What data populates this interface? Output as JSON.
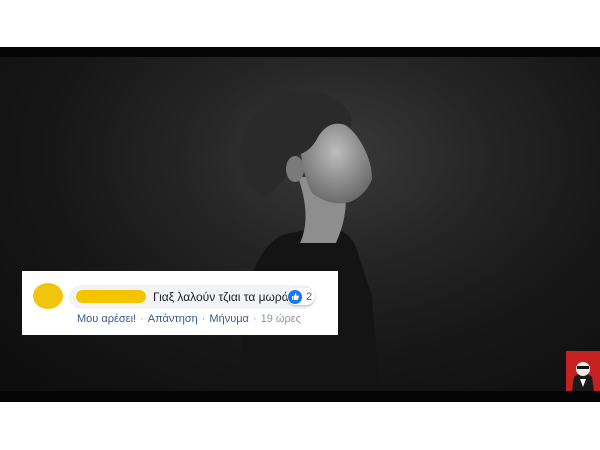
{
  "comment": {
    "text": "Γιαξ λαλούν τζιαι τα μωρά !",
    "reaction_count": "2",
    "actions": {
      "like": "Μου αρέσει!",
      "reply": "Απάντηση",
      "message": "Μήνυμα",
      "time": "19 ώρες"
    },
    "separator": "·"
  },
  "colors": {
    "link": "#385898",
    "like_blue": "#1877f2",
    "redaction_yellow": "#f5c400",
    "video_bg": "#050505",
    "badge_red": "#c62020"
  }
}
